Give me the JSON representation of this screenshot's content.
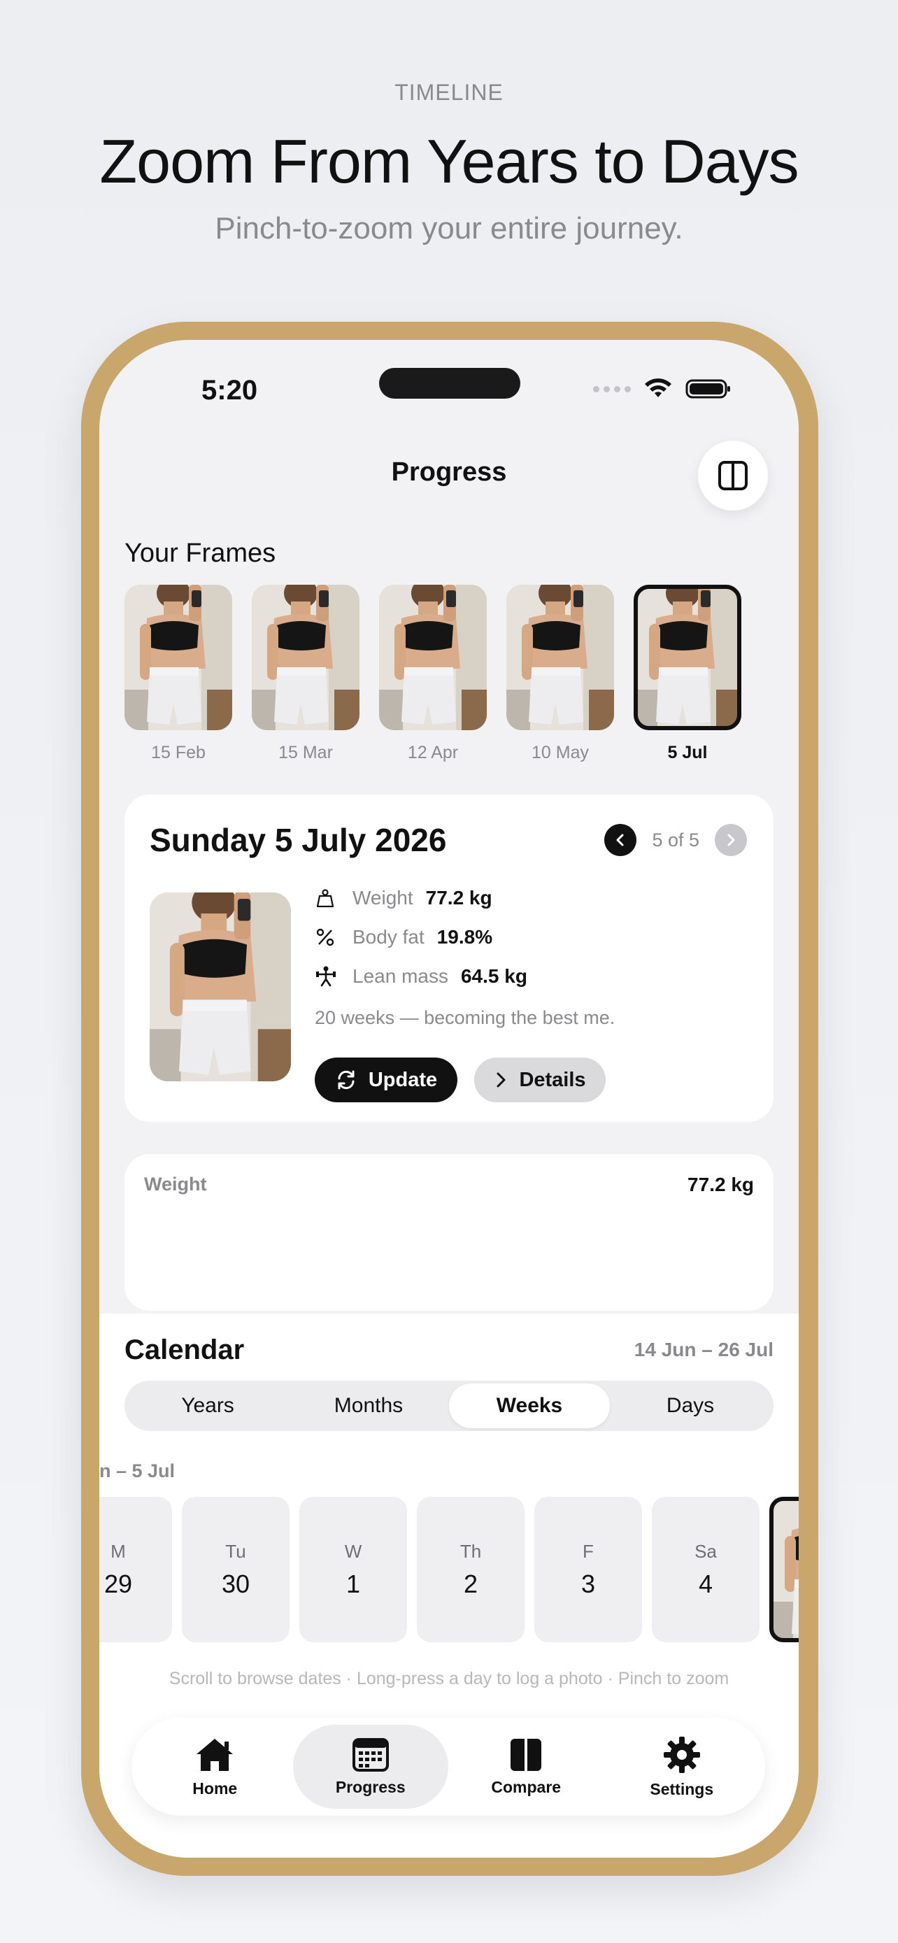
{
  "header": {
    "eyebrow": "TIMELINE",
    "headline": "Zoom From Years to Days",
    "subhead": "Pinch-to-zoom your entire journey."
  },
  "status_bar": {
    "time": "5:20"
  },
  "nav": {
    "title": "Progress",
    "compare_icon": "split-view-icon"
  },
  "frames": {
    "title": "Your Frames",
    "items": [
      {
        "date": "15 Feb",
        "selected": false
      },
      {
        "date": "15 Mar",
        "selected": false
      },
      {
        "date": "12 Apr",
        "selected": false
      },
      {
        "date": "10 May",
        "selected": false
      },
      {
        "date": "5 Jul",
        "selected": true
      }
    ]
  },
  "detail": {
    "title": "Sunday 5 July 2026",
    "pager": "5 of 5",
    "metrics": [
      {
        "icon": "weight-icon",
        "label": "Weight",
        "value": "77.2 kg"
      },
      {
        "icon": "percent-icon",
        "label": "Body fat",
        "value": "19.8%"
      },
      {
        "icon": "lean-mass-icon",
        "label": "Lean mass",
        "value": "64.5 kg"
      }
    ],
    "note": "20 weeks — becoming the best me.",
    "update_label": "Update",
    "details_label": "Details"
  },
  "weight_card": {
    "label": "Weight",
    "value": "77.2 kg"
  },
  "calendar": {
    "title": "Calendar",
    "range": "14 Jun – 26 Jul",
    "segments": [
      {
        "label": "Years",
        "active": false
      },
      {
        "label": "Months",
        "active": false
      },
      {
        "label": "Weeks",
        "active": true
      },
      {
        "label": "Days",
        "active": false
      }
    ],
    "week_label": "n – 5 Jul",
    "days": [
      {
        "dow": "M",
        "num": "29"
      },
      {
        "dow": "Tu",
        "num": "30"
      },
      {
        "dow": "W",
        "num": "1"
      },
      {
        "dow": "Th",
        "num": "2"
      },
      {
        "dow": "F",
        "num": "3"
      },
      {
        "dow": "Sa",
        "num": "4"
      }
    ],
    "hint": "Scroll to browse dates · Long-press a day to log a photo · Pinch to zoom"
  },
  "tabbar": {
    "items": [
      {
        "label": "Home",
        "icon": "home-icon",
        "active": false
      },
      {
        "label": "Progress",
        "icon": "calendar-icon",
        "active": true
      },
      {
        "label": "Compare",
        "icon": "compare-icon",
        "active": false
      },
      {
        "label": "Settings",
        "icon": "gear-icon",
        "active": false
      }
    ]
  },
  "colors": {
    "frame_gold": "#c9a66b",
    "accent": "#111111",
    "muted": "#8a8a8e"
  }
}
